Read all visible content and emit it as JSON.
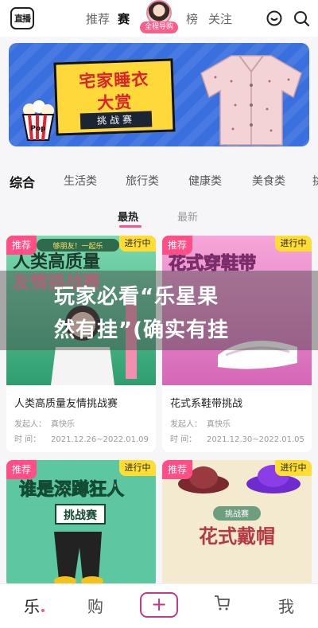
{
  "topbar": {
    "logo_text": "直播",
    "nav": [
      "推荐",
      "赛",
      "榜",
      "关注"
    ],
    "guide_badge": "全程导购"
  },
  "banner": {
    "title_line1": "宅家睡衣",
    "title_line2": "大赏",
    "tag": "挑战赛",
    "popcorn_label": "Pop"
  },
  "categories": [
    "综合",
    "生活类",
    "旅行类",
    "健康类",
    "美食类",
    "挑"
  ],
  "sort": [
    "最热",
    "最新"
  ],
  "cards": [
    {
      "rec": "推荐",
      "status": "进行中",
      "image_text_top": "够朋友！一起乐",
      "image_text_line1": "人类高质量",
      "image_text_line2": "友情挑战赛",
      "title": "人类高质量友情挑战赛",
      "initiator_label": "发起人：",
      "initiator": "真快乐",
      "time_label": "时 间：",
      "time": "2021.12.26~2022.01.09"
    },
    {
      "rec": "推荐",
      "status": "进行中",
      "image_text_line1": "花式穿鞋带",
      "title": "花式系鞋带挑战",
      "initiator_label": "发起人：",
      "initiator": "真快乐",
      "time_label": "时 间：",
      "time": "2021.12.30~2022.01.05"
    },
    {
      "rec": "推荐",
      "status": "进行中",
      "image_text_line1": "谁是深蹲狂人",
      "image_text_line2": "挑战赛"
    },
    {
      "rec": "推荐",
      "status": "进行中",
      "image_text_line1": "挑战赛",
      "image_text_line2": "花式戴帽"
    }
  ],
  "overlay": {
    "line1": "玩家必看“乐星果",
    "line2": "然有挂”(确实有挂"
  },
  "bottombar": {
    "items": [
      "乐",
      "购",
      "+",
      "",
      "我"
    ]
  },
  "colors": {
    "accent_pink": "#ff4f86",
    "status_yellow": "#ffdd33",
    "plus_purple": "#c23a8a"
  }
}
